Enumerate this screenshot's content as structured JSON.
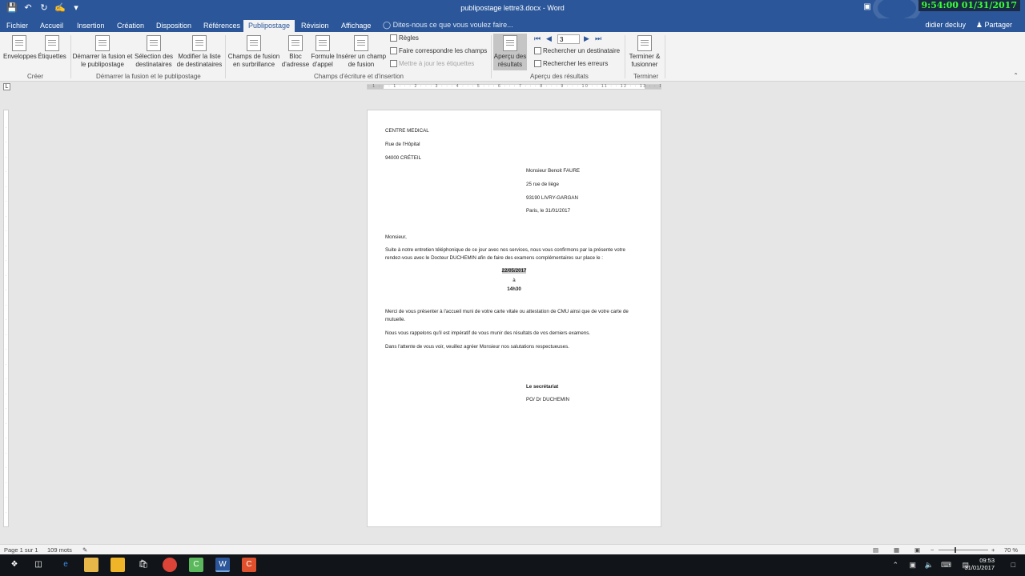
{
  "window": {
    "title": "publipostage lettre3.docx - Word",
    "clock_overlay": "9:54:00  01/31/2017"
  },
  "qat": {
    "save_icon": "save-icon",
    "undo_icon": "undo-icon",
    "redo_icon": "redo-icon",
    "touch_icon": "touch-mode-icon",
    "customize_icon": "customize-qat-icon"
  },
  "tabs": [
    "Fichier",
    "Accueil",
    "Insertion",
    "Création",
    "Disposition",
    "Références",
    "Publipostage",
    "Révision",
    "Affichage"
  ],
  "active_tab": "Publipostage",
  "tell_me": "Dites-nous ce que vous voulez faire...",
  "user": "didier decluy",
  "share": "Partager",
  "ribbon": {
    "creer": {
      "label": "Créer",
      "enveloppes": "Enveloppes",
      "etiquettes": "Étiquettes"
    },
    "demarrer": {
      "label": "Démarrer la fusion et le publipostage",
      "btn1_l1": "Démarrer la fusion et",
      "btn1_l2": "le publipostage",
      "btn2_l1": "Sélection des",
      "btn2_l2": "destinataires",
      "btn3_l1": "Modifier la liste",
      "btn3_l2": "de destinataires"
    },
    "champs": {
      "label": "Champs d'écriture et d'insertion",
      "btn1_l1": "Champs de fusion",
      "btn1_l2": "en surbrillance",
      "btn2_l1": "Bloc",
      "btn2_l2": "d'adresse",
      "btn3_l1": "Formule",
      "btn3_l2": "d'appel",
      "btn4_l1": "Insérer un champ",
      "btn4_l2": "de fusion",
      "regles": "Règles",
      "faire": "Faire correspondre les champs",
      "maj": "Mettre à jour les étiquettes"
    },
    "apercu": {
      "label": "Aperçu des résultats",
      "btn_l1": "Aperçu des",
      "btn_l2": "résultats",
      "record": "3",
      "rechercher_dest": "Rechercher un destinataire",
      "rechercher_err": "Rechercher les erreurs"
    },
    "terminer": {
      "label": "Terminer",
      "btn_l1": "Terminer &",
      "btn_l2": "fusionner"
    }
  },
  "document": {
    "sender": [
      "CENTRE MEDICAL",
      "Rue de l'Hôpital",
      "94000 CRÉTEIL"
    ],
    "recipient": [
      "Monsieur Benoit FAURE",
      "25 rue de liège",
      "93190 LIVRY-GARGAN",
      "Paris, le 31/01/2017"
    ],
    "salutation": "Monsieur,",
    "para1": "Suite à notre entretien téléphonique de ce jour avec nos services, nous vous confirmons par la présente votre rendez-vous avec le Docteur DUCHEMIN afin de faire des examens complémentaires sur place le :",
    "date": "22/05/2017",
    "a": "à",
    "time": "14h30",
    "para2": "Merci de vous présenter à l'accueil muni de votre carte vitale ou attestation de CMU ainsi que de votre carte de mutuelle.",
    "para3": "Nous vous rappelons qu'il est impératif de vous munir des résultats de vos derniers examens.",
    "para4": "Dans l'attente de vous voir, veuillez agréer Monsieur nos salutations respectueuses.",
    "signature_title": "Le secrétariat",
    "signature_name": "PO/ Dr DUCHEMIN"
  },
  "statusbar": {
    "page": "Page 1 sur 1",
    "words": "109 mots",
    "zoom": "70 %"
  },
  "taskbar": {
    "time": "09:53",
    "date": "31/01/2017"
  },
  "colors": {
    "word_blue": "#2b579a",
    "ribbon_bg": "#f3f3f3",
    "canvas_bg": "#e6e6e6",
    "clock_green": "#38ff38"
  }
}
